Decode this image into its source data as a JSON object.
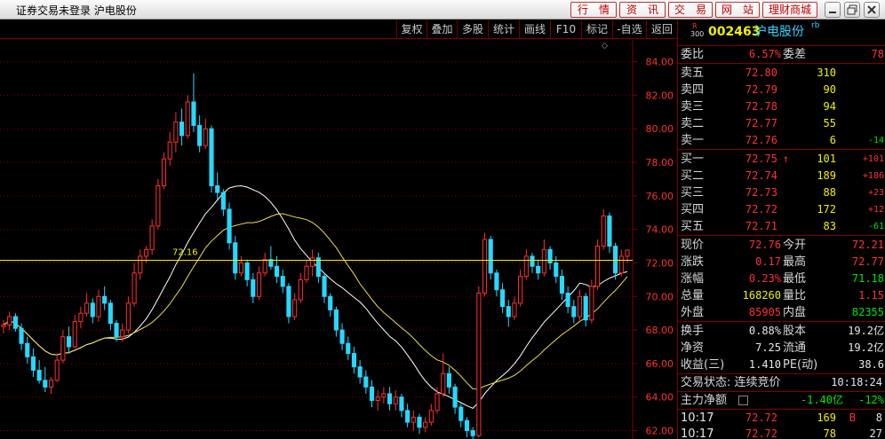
{
  "window": {
    "title": "证券交易未登录  沪电股份"
  },
  "nav_buttons": [
    "行　情",
    "资　讯",
    "交　易",
    "网　站",
    "理财商城"
  ],
  "toolbar": [
    "复权",
    "叠加",
    "多股",
    "统计",
    "画线",
    "F10",
    "标记",
    "-自选",
    "返回"
  ],
  "stock": {
    "badge_top": "R",
    "badge_bottom": "300",
    "code": "002463",
    "name": "沪电股份",
    "sup": "rb"
  },
  "order_ratio": {
    "label": "委比",
    "value": "6.57%",
    "diff_label": "委差",
    "diff": "78"
  },
  "asks": [
    {
      "label": "卖五",
      "price": "72.80",
      "vol": "310",
      "chg": ""
    },
    {
      "label": "卖四",
      "price": "72.79",
      "vol": "90",
      "chg": ""
    },
    {
      "label": "卖三",
      "price": "72.78",
      "vol": "94",
      "chg": ""
    },
    {
      "label": "卖二",
      "price": "72.77",
      "vol": "55",
      "chg": ""
    },
    {
      "label": "卖一",
      "price": "72.76",
      "vol": "6",
      "chg": "-14"
    }
  ],
  "bids": [
    {
      "label": "买一",
      "price": "72.75",
      "arrow": "↑",
      "vol": "101",
      "chg": "+101"
    },
    {
      "label": "买二",
      "price": "72.74",
      "arrow": "",
      "vol": "189",
      "chg": "+186"
    },
    {
      "label": "买三",
      "price": "72.73",
      "arrow": "",
      "vol": "88",
      "chg": "+23"
    },
    {
      "label": "买四",
      "price": "72.72",
      "arrow": "",
      "vol": "172",
      "chg": "+12"
    },
    {
      "label": "买五",
      "price": "72.71",
      "arrow": "",
      "vol": "83",
      "chg": "-61"
    }
  ],
  "quote": [
    {
      "l1": "现价",
      "v1": "72.76",
      "l2": "今开",
      "v2": "72.21"
    },
    {
      "l1": "涨跌",
      "v1": "0.17",
      "l2": "最高",
      "v2": "72.77"
    },
    {
      "l1": "涨幅",
      "v1": "0.23%",
      "l2": "最低",
      "v2": "71.18"
    },
    {
      "l1": "总量",
      "v1": "168260",
      "l2": "量比",
      "v2": "1.15"
    },
    {
      "l1": "外盘",
      "v1": "85905",
      "l2": "内盘",
      "v2": "82355"
    }
  ],
  "fundamentals": [
    {
      "l1": "换手",
      "v1": "0.88%",
      "l2": "股本",
      "v2": "19.2亿"
    },
    {
      "l1": "净资",
      "v1": "7.25",
      "l2": "流通",
      "v2": "19.2亿"
    },
    {
      "l1": "收益(三)",
      "v1": "1.410",
      "l2": "PE(动)",
      "v2": "38.6"
    }
  ],
  "status": {
    "label": "交易状态: 连续竞价",
    "time": "10:18:24"
  },
  "flow": {
    "label": "主力净额",
    "value": "-1.40亿",
    "pct": "-12%"
  },
  "ticks": [
    {
      "time": "10:17",
      "price": "72.72",
      "vol": "169",
      "side": "B",
      "n": "8"
    },
    {
      "time": "10:17",
      "price": "72.72",
      "vol": "78",
      "side": "",
      "n": "27"
    }
  ],
  "chart_data": {
    "type": "candlestick",
    "y_ticks": [
      "84.00",
      "82.00",
      "80.00",
      "78.00",
      "76.00",
      "74.00",
      "72.00",
      "70.00",
      "68.00",
      "66.00",
      "64.00",
      "62.00"
    ],
    "ylim": [
      61.5,
      85.3
    ],
    "ref_price": 72.16,
    "ref_label": "72.16",
    "colors": {
      "up": "#ff3030",
      "down": "#27d8ff",
      "ma1": "#ffffff",
      "ma2": "#f0e040",
      "ref": "#f0f000"
    },
    "candles": [
      [
        68.2,
        68.6,
        67.8,
        68.3
      ],
      [
        68.3,
        69.1,
        68.0,
        68.8
      ],
      [
        68.8,
        69.0,
        67.9,
        68.1
      ],
      [
        68.1,
        68.4,
        66.8,
        67.2
      ],
      [
        67.2,
        67.6,
        66.0,
        66.4
      ],
      [
        66.4,
        66.9,
        65.2,
        65.6
      ],
      [
        65.6,
        66.2,
        64.8,
        65.0
      ],
      [
        65.0,
        65.8,
        64.3,
        64.6
      ],
      [
        64.6,
        65.2,
        64.2,
        65.0
      ],
      [
        65.0,
        66.6,
        64.9,
        66.2
      ],
      [
        66.2,
        68.0,
        66.0,
        67.6
      ],
      [
        67.6,
        68.2,
        66.6,
        67.0
      ],
      [
        67.0,
        68.9,
        66.9,
        68.5
      ],
      [
        68.5,
        69.4,
        68.1,
        69.0
      ],
      [
        69.0,
        70.2,
        68.8,
        69.6
      ],
      [
        69.6,
        69.9,
        68.4,
        68.8
      ],
      [
        68.8,
        70.4,
        68.5,
        70.0
      ],
      [
        70.0,
        70.6,
        69.2,
        69.6
      ],
      [
        69.6,
        69.8,
        68.0,
        68.4
      ],
      [
        68.4,
        68.6,
        67.3,
        67.6
      ],
      [
        67.6,
        68.4,
        67.3,
        68.0
      ],
      [
        68.0,
        70.0,
        67.8,
        69.6
      ],
      [
        69.6,
        72.0,
        69.4,
        71.4
      ],
      [
        71.4,
        72.8,
        71.0,
        72.4
      ],
      [
        72.4,
        73.0,
        72.0,
        72.8
      ],
      [
        72.8,
        74.6,
        72.5,
        74.2
      ],
      [
        74.2,
        77.0,
        74.0,
        76.6
      ],
      [
        76.6,
        78.6,
        76.4,
        78.2
      ],
      [
        78.2,
        79.8,
        77.8,
        79.2
      ],
      [
        79.2,
        81.0,
        78.6,
        80.4
      ],
      [
        80.4,
        81.2,
        79.0,
        79.6
      ],
      [
        79.6,
        82.0,
        79.4,
        81.6
      ],
      [
        81.6,
        83.3,
        79.8,
        80.2
      ],
      [
        80.2,
        80.8,
        78.6,
        79.0
      ],
      [
        79.0,
        80.6,
        78.8,
        80.0
      ],
      [
        80.0,
        80.2,
        76.2,
        76.6
      ],
      [
        76.6,
        77.4,
        75.8,
        76.2
      ],
      [
        76.2,
        76.4,
        74.8,
        75.2
      ],
      [
        75.2,
        75.6,
        72.8,
        73.2
      ],
      [
        73.2,
        73.6,
        71.0,
        71.4
      ],
      [
        71.4,
        72.4,
        71.2,
        72.0
      ],
      [
        72.0,
        72.2,
        70.6,
        71.0
      ],
      [
        71.0,
        71.4,
        69.6,
        70.0
      ],
      [
        70.0,
        71.8,
        69.8,
        71.4
      ],
      [
        71.4,
        72.6,
        71.2,
        72.2
      ],
      [
        72.2,
        73.0,
        71.6,
        71.8
      ],
      [
        71.8,
        72.4,
        70.8,
        71.2
      ],
      [
        71.2,
        71.6,
        70.2,
        70.6
      ],
      [
        70.6,
        70.8,
        68.4,
        68.8
      ],
      [
        68.8,
        70.2,
        68.6,
        69.8
      ],
      [
        69.8,
        71.4,
        69.6,
        71.0
      ],
      [
        71.0,
        72.2,
        70.8,
        71.8
      ],
      [
        71.8,
        72.8,
        71.2,
        72.3
      ],
      [
        72.3,
        72.6,
        70.8,
        71.2
      ],
      [
        71.2,
        71.4,
        69.6,
        70.0
      ],
      [
        70.0,
        70.2,
        68.8,
        69.2
      ],
      [
        69.2,
        69.4,
        67.6,
        68.0
      ],
      [
        68.0,
        68.4,
        66.8,
        67.2
      ],
      [
        67.2,
        67.6,
        66.2,
        66.6
      ],
      [
        66.6,
        67.0,
        65.4,
        65.8
      ],
      [
        65.8,
        66.2,
        64.8,
        65.2
      ],
      [
        65.2,
        65.6,
        64.2,
        64.6
      ],
      [
        64.6,
        65.0,
        63.4,
        63.8
      ],
      [
        63.8,
        64.4,
        63.2,
        64.0
      ],
      [
        64.0,
        64.6,
        63.6,
        64.2
      ],
      [
        64.2,
        64.6,
        63.2,
        63.6
      ],
      [
        63.6,
        64.4,
        63.2,
        64.0
      ],
      [
        64.0,
        64.2,
        62.8,
        63.2
      ],
      [
        63.2,
        63.6,
        62.2,
        62.5
      ],
      [
        62.5,
        63.2,
        62.0,
        62.8
      ],
      [
        62.8,
        63.0,
        61.8,
        62.2
      ],
      [
        62.2,
        62.8,
        61.9,
        62.5
      ],
      [
        62.5,
        63.6,
        62.3,
        63.2
      ],
      [
        63.2,
        64.6,
        63.0,
        64.2
      ],
      [
        64.2,
        66.6,
        64.0,
        65.4
      ],
      [
        65.4,
        65.8,
        64.2,
        64.6
      ],
      [
        64.6,
        64.8,
        63.0,
        63.4
      ],
      [
        63.4,
        63.6,
        62.2,
        62.6
      ],
      [
        62.6,
        62.8,
        61.6,
        62.0
      ],
      [
        62.0,
        62.2,
        61.4,
        61.7
      ],
      [
        61.7,
        70.6,
        61.6,
        70.2
      ],
      [
        70.2,
        73.8,
        70.0,
        73.4
      ],
      [
        73.4,
        73.6,
        71.0,
        71.4
      ],
      [
        71.4,
        71.6,
        70.0,
        70.4
      ],
      [
        70.4,
        70.8,
        69.0,
        69.4
      ],
      [
        69.4,
        69.8,
        68.2,
        68.8
      ],
      [
        68.8,
        70.0,
        68.6,
        69.6
      ],
      [
        69.6,
        71.6,
        69.4,
        71.2
      ],
      [
        71.2,
        72.8,
        71.0,
        72.4
      ],
      [
        72.4,
        72.6,
        71.4,
        71.8
      ],
      [
        71.8,
        72.2,
        71.0,
        71.4
      ],
      [
        71.4,
        73.4,
        71.2,
        72.8
      ],
      [
        72.8,
        73.0,
        71.6,
        72.0
      ],
      [
        72.0,
        72.4,
        70.8,
        71.2
      ],
      [
        71.2,
        71.6,
        69.8,
        70.2
      ],
      [
        70.2,
        70.6,
        69.0,
        69.4
      ],
      [
        69.4,
        69.8,
        68.4,
        68.8
      ],
      [
        68.8,
        70.4,
        68.6,
        70.0
      ],
      [
        70.0,
        70.2,
        68.2,
        68.6
      ],
      [
        68.6,
        71.0,
        68.4,
        70.6
      ],
      [
        70.6,
        73.4,
        70.4,
        73.0
      ],
      [
        73.0,
        75.2,
        72.8,
        74.8
      ],
      [
        74.8,
        75.0,
        72.6,
        73.0
      ],
      [
        73.0,
        73.2,
        71.0,
        71.4
      ],
      [
        71.4,
        72.8,
        71.2,
        72.4
      ],
      [
        72.4,
        72.8,
        72.0,
        72.76
      ]
    ]
  }
}
